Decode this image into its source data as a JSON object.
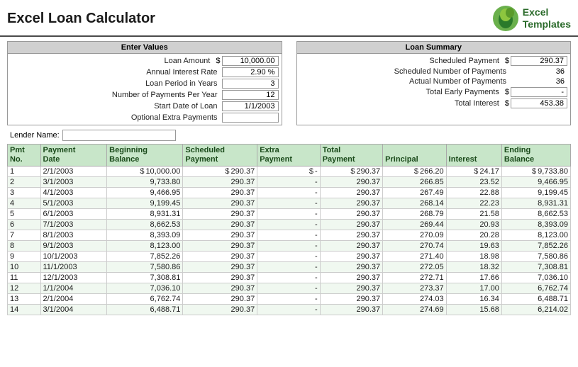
{
  "header": {
    "title": "Excel Loan Calculator",
    "logo_line1": "Excel",
    "logo_line2": "Templates"
  },
  "enter_values": {
    "header": "Enter Values",
    "fields": [
      {
        "label": "Loan Amount",
        "dollar": "$",
        "value": "10,000.00"
      },
      {
        "label": "Annual Interest Rate",
        "value": "2.90  %"
      },
      {
        "label": "Loan Period in Years",
        "value": "3"
      },
      {
        "label": "Number of Payments Per Year",
        "value": "12"
      },
      {
        "label": "Start Date of Loan",
        "value": "1/1/2003"
      },
      {
        "label": "Optional Extra Payments",
        "value": ""
      }
    ]
  },
  "loan_summary": {
    "header": "Loan Summary",
    "fields": [
      {
        "label": "Scheduled Payment",
        "dollar": "$",
        "value": "290.37"
      },
      {
        "label": "Scheduled Number of Payments",
        "value": "36"
      },
      {
        "label": "Actual Number of Payments",
        "value": "36"
      },
      {
        "label": "Total Early Payments",
        "dollar": "$",
        "value": "-"
      },
      {
        "label": "Total Interest",
        "dollar": "$",
        "value": "453.38"
      }
    ]
  },
  "lender": {
    "label": "Lender Name:",
    "value": ""
  },
  "table": {
    "columns": [
      {
        "header": "Pmt\nNo.",
        "key": "pmt"
      },
      {
        "header": "Payment\nDate",
        "key": "date"
      },
      {
        "header": "Beginning\nBalance",
        "key": "beg_bal"
      },
      {
        "header": "Scheduled\nPayment",
        "key": "sched_pay"
      },
      {
        "header": "Extra\nPayment",
        "key": "extra_pay"
      },
      {
        "header": "Total\nPayment",
        "key": "total_pay"
      },
      {
        "header": "Principal",
        "key": "principal"
      },
      {
        "header": "Interest",
        "key": "interest"
      },
      {
        "header": "Ending\nBalance",
        "key": "end_bal"
      }
    ],
    "rows": [
      {
        "pmt": "1",
        "date": "2/1/2003",
        "beg_bal": "10,000.00",
        "sched_pay": "290.37",
        "extra_pay": "-",
        "total_pay": "290.37",
        "principal": "266.20",
        "interest": "24.17",
        "end_bal": "9,733.80"
      },
      {
        "pmt": "2",
        "date": "3/1/2003",
        "beg_bal": "9,733.80",
        "sched_pay": "290.37",
        "extra_pay": "-",
        "total_pay": "290.37",
        "principal": "266.85",
        "interest": "23.52",
        "end_bal": "9,466.95"
      },
      {
        "pmt": "3",
        "date": "4/1/2003",
        "beg_bal": "9,466.95",
        "sched_pay": "290.37",
        "extra_pay": "-",
        "total_pay": "290.37",
        "principal": "267.49",
        "interest": "22.88",
        "end_bal": "9,199.45"
      },
      {
        "pmt": "4",
        "date": "5/1/2003",
        "beg_bal": "9,199.45",
        "sched_pay": "290.37",
        "extra_pay": "-",
        "total_pay": "290.37",
        "principal": "268.14",
        "interest": "22.23",
        "end_bal": "8,931.31"
      },
      {
        "pmt": "5",
        "date": "6/1/2003",
        "beg_bal": "8,931.31",
        "sched_pay": "290.37",
        "extra_pay": "-",
        "total_pay": "290.37",
        "principal": "268.79",
        "interest": "21.58",
        "end_bal": "8,662.53"
      },
      {
        "pmt": "6",
        "date": "7/1/2003",
        "beg_bal": "8,662.53",
        "sched_pay": "290.37",
        "extra_pay": "-",
        "total_pay": "290.37",
        "principal": "269.44",
        "interest": "20.93",
        "end_bal": "8,393.09"
      },
      {
        "pmt": "7",
        "date": "8/1/2003",
        "beg_bal": "8,393.09",
        "sched_pay": "290.37",
        "extra_pay": "-",
        "total_pay": "290.37",
        "principal": "270.09",
        "interest": "20.28",
        "end_bal": "8,123.00"
      },
      {
        "pmt": "8",
        "date": "9/1/2003",
        "beg_bal": "8,123.00",
        "sched_pay": "290.37",
        "extra_pay": "-",
        "total_pay": "290.37",
        "principal": "270.74",
        "interest": "19.63",
        "end_bal": "7,852.26"
      },
      {
        "pmt": "9",
        "date": "10/1/2003",
        "beg_bal": "7,852.26",
        "sched_pay": "290.37",
        "extra_pay": "-",
        "total_pay": "290.37",
        "principal": "271.40",
        "interest": "18.98",
        "end_bal": "7,580.86"
      },
      {
        "pmt": "10",
        "date": "11/1/2003",
        "beg_bal": "7,580.86",
        "sched_pay": "290.37",
        "extra_pay": "-",
        "total_pay": "290.37",
        "principal": "272.05",
        "interest": "18.32",
        "end_bal": "7,308.81"
      },
      {
        "pmt": "11",
        "date": "12/1/2003",
        "beg_bal": "7,308.81",
        "sched_pay": "290.37",
        "extra_pay": "-",
        "total_pay": "290.37",
        "principal": "272.71",
        "interest": "17.66",
        "end_bal": "7,036.10"
      },
      {
        "pmt": "12",
        "date": "1/1/2004",
        "beg_bal": "7,036.10",
        "sched_pay": "290.37",
        "extra_pay": "-",
        "total_pay": "290.37",
        "principal": "273.37",
        "interest": "17.00",
        "end_bal": "6,762.74"
      },
      {
        "pmt": "13",
        "date": "2/1/2004",
        "beg_bal": "6,762.74",
        "sched_pay": "290.37",
        "extra_pay": "-",
        "total_pay": "290.37",
        "principal": "274.03",
        "interest": "16.34",
        "end_bal": "6,488.71"
      },
      {
        "pmt": "14",
        "date": "3/1/2004",
        "beg_bal": "6,488.71",
        "sched_pay": "290.37",
        "extra_pay": "-",
        "total_pay": "290.37",
        "principal": "274.69",
        "interest": "15.68",
        "end_bal": "6,214.02"
      }
    ]
  }
}
